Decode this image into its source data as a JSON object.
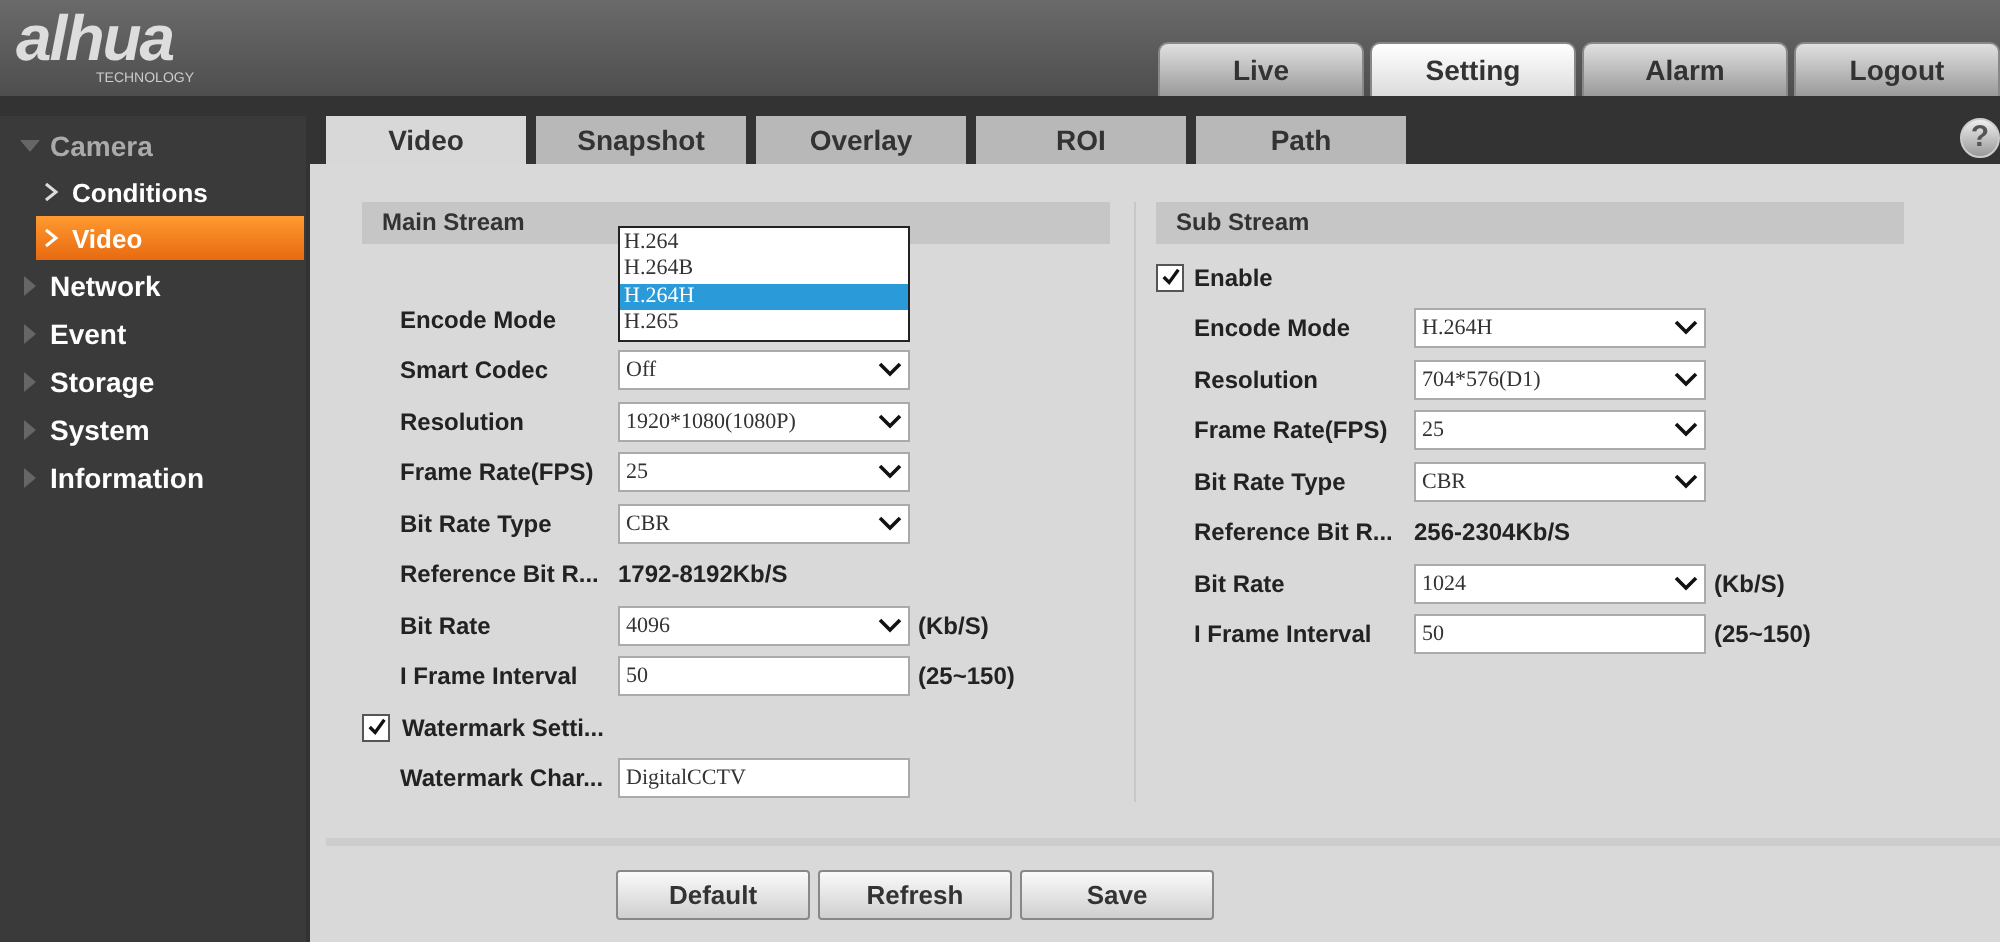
{
  "logo": {
    "name": "alhua",
    "tagline": "TECHNOLOGY"
  },
  "top_tabs": [
    {
      "label": "Live",
      "selected": false
    },
    {
      "label": "Setting",
      "selected": true
    },
    {
      "label": "Alarm",
      "selected": false
    },
    {
      "label": "Logout",
      "selected": false
    }
  ],
  "sidebar": {
    "items": [
      {
        "label": "Camera",
        "expanded": true,
        "selected": false,
        "children": [
          {
            "label": "Conditions",
            "selected": false
          },
          {
            "label": "Video",
            "selected": true
          }
        ]
      },
      {
        "label": "Network",
        "expanded": false,
        "selected": false
      },
      {
        "label": "Event",
        "expanded": false,
        "selected": false
      },
      {
        "label": "Storage",
        "expanded": false,
        "selected": false
      },
      {
        "label": "System",
        "expanded": false,
        "selected": false
      },
      {
        "label": "Information",
        "expanded": false,
        "selected": false
      }
    ]
  },
  "sub_tabs": [
    {
      "label": "Video",
      "selected": true
    },
    {
      "label": "Snapshot",
      "selected": false
    },
    {
      "label": "Overlay",
      "selected": false
    },
    {
      "label": "ROI",
      "selected": false
    },
    {
      "label": "Path",
      "selected": false
    }
  ],
  "help_icon": "?",
  "main_stream": {
    "title": "Main Stream",
    "rows": [
      {
        "kind": "open_select",
        "label": "Encode Mode",
        "options": [
          {
            "label": "H.264",
            "selected": false
          },
          {
            "label": "H.264B",
            "selected": false
          },
          {
            "label": "H.264H",
            "selected": true
          },
          {
            "label": "H.265",
            "selected": false
          }
        ]
      },
      {
        "kind": "select",
        "label": "Smart Codec",
        "value": "Off"
      },
      {
        "kind": "select",
        "label": "Resolution",
        "value": "1920*1080(1080P)"
      },
      {
        "kind": "select",
        "label": "Frame Rate(FPS)",
        "value": "25"
      },
      {
        "kind": "select",
        "label": "Bit Rate Type",
        "value": "CBR"
      },
      {
        "kind": "text",
        "label": "Reference Bit R...",
        "value": "1792-8192Kb/S"
      },
      {
        "kind": "select",
        "label": "Bit Rate",
        "value": "4096",
        "unit": "(Kb/S)"
      },
      {
        "kind": "input",
        "label": "I Frame Interval",
        "value": "50",
        "unit": "(25~150)"
      },
      {
        "kind": "checkbox",
        "label": "Watermark Setti...",
        "checked": true
      },
      {
        "kind": "input",
        "label": "Watermark Char...",
        "value": "DigitalCCTV"
      }
    ]
  },
  "sub_stream": {
    "title": "Sub Stream",
    "rows": [
      {
        "kind": "checkbox",
        "label": "Enable",
        "checked": true
      },
      {
        "kind": "select",
        "label": "Encode Mode",
        "value": "H.264H"
      },
      {
        "kind": "select",
        "label": "Resolution",
        "value": "704*576(D1)"
      },
      {
        "kind": "select",
        "label": "Frame Rate(FPS)",
        "value": "25"
      },
      {
        "kind": "select",
        "label": "Bit Rate Type",
        "value": "CBR"
      },
      {
        "kind": "text",
        "label": "Reference Bit R...",
        "value": "256-2304Kb/S"
      },
      {
        "kind": "select",
        "label": "Bit Rate",
        "value": "1024",
        "unit": "(Kb/S)"
      },
      {
        "kind": "input",
        "label": "I Frame Interval",
        "value": "50",
        "unit": "(25~150)"
      }
    ]
  },
  "buttons": [
    "Default",
    "Refresh",
    "Save"
  ]
}
